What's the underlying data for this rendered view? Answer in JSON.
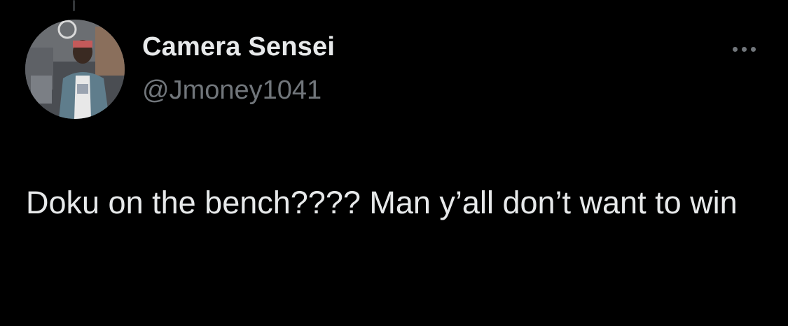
{
  "tweet": {
    "author": {
      "display_name": "Camera Sensei",
      "handle": "@Jmoney1041",
      "avatar_icon": "profile-photo"
    },
    "more_icon": "more-horizontal-icon",
    "text": "Doku on the bench???? Man y’all don’t want to win"
  },
  "colors": {
    "background": "#000000",
    "primary_text": "#e7e9ea",
    "secondary_text": "#71767b"
  }
}
